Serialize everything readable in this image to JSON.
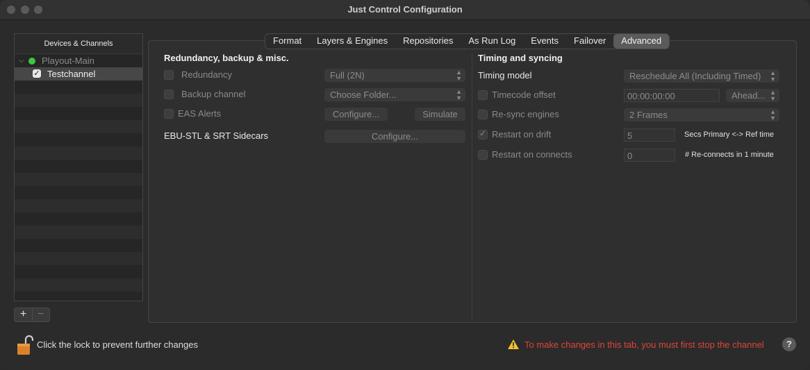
{
  "window": {
    "title": "Just Control Configuration"
  },
  "sidebar": {
    "header": "Devices & Channels",
    "items": [
      {
        "label": "Playout-Main",
        "status_color": "#3cc83c"
      },
      {
        "label": "Testchannel",
        "checked": true
      }
    ]
  },
  "tabs": [
    {
      "label": "Format"
    },
    {
      "label": "Layers & Engines"
    },
    {
      "label": "Repositories"
    },
    {
      "label": "As Run Log"
    },
    {
      "label": "Events"
    },
    {
      "label": "Failover"
    },
    {
      "label": "Advanced"
    }
  ],
  "active_tab": "Advanced",
  "left_section": {
    "title": "Redundancy, backup & misc.",
    "redundancy": {
      "label": "Redundancy",
      "value": "Full (2N)"
    },
    "backup": {
      "label": "Backup channel",
      "value": "Choose Folder..."
    },
    "eas": {
      "label": "EAS Alerts",
      "configure": "Configure...",
      "simulate": "Simulate"
    },
    "ebu": {
      "label": "EBU-STL & SRT Sidecars",
      "configure": "Configure..."
    }
  },
  "right_section": {
    "title": "Timing and syncing",
    "timing_model": {
      "label": "Timing model",
      "value": "Reschedule All (Including Timed)"
    },
    "timecode": {
      "label": "Timecode offset",
      "value": "00:00:00:00",
      "direction": "Ahead..."
    },
    "resync": {
      "label": "Re-sync engines",
      "value": "2 Frames"
    },
    "drift": {
      "label": "Restart on drift",
      "value": "5",
      "unit": "Secs Primary <-> Ref time",
      "checked": true
    },
    "connects": {
      "label": "Restart on connects",
      "value": "0",
      "unit": "# Re-connects in 1 minute"
    }
  },
  "footer": {
    "lock_text": "Click the lock to prevent further changes",
    "warning": "To make changes in this tab, you must first stop the channel",
    "warning_color": "#e0443a"
  },
  "buttons": {
    "add": "+",
    "remove": "−",
    "help": "?"
  }
}
